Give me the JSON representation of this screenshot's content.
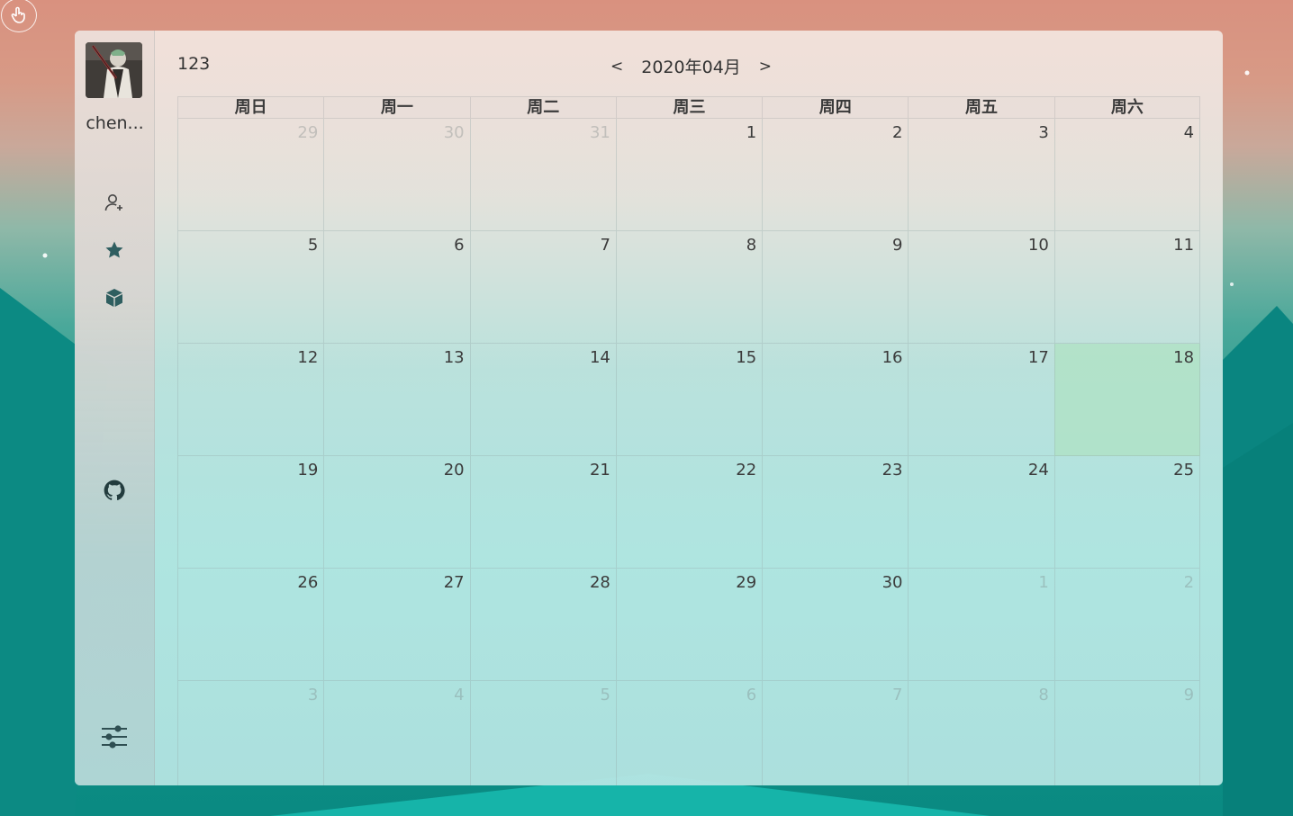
{
  "sidebar": {
    "username": "chen...",
    "icons": [
      "add-user-icon",
      "star-icon",
      "cube-icon",
      "github-icon",
      "settings-sliders-icon"
    ]
  },
  "header": {
    "title": "123",
    "prev_label": "<",
    "month": "2020年04月",
    "next_label": ">"
  },
  "calendar": {
    "weekdays": [
      "周日",
      "周一",
      "周二",
      "周三",
      "周四",
      "周五",
      "周六"
    ],
    "today": 18,
    "days": [
      {
        "n": "29",
        "current": false
      },
      {
        "n": "30",
        "current": false
      },
      {
        "n": "31",
        "current": false
      },
      {
        "n": "1",
        "current": true
      },
      {
        "n": "2",
        "current": true
      },
      {
        "n": "3",
        "current": true
      },
      {
        "n": "4",
        "current": true
      },
      {
        "n": "5",
        "current": true
      },
      {
        "n": "6",
        "current": true
      },
      {
        "n": "7",
        "current": true
      },
      {
        "n": "8",
        "current": true
      },
      {
        "n": "9",
        "current": true
      },
      {
        "n": "10",
        "current": true
      },
      {
        "n": "11",
        "current": true
      },
      {
        "n": "12",
        "current": true
      },
      {
        "n": "13",
        "current": true
      },
      {
        "n": "14",
        "current": true
      },
      {
        "n": "15",
        "current": true
      },
      {
        "n": "16",
        "current": true
      },
      {
        "n": "17",
        "current": true
      },
      {
        "n": "18",
        "current": true
      },
      {
        "n": "19",
        "current": true
      },
      {
        "n": "20",
        "current": true
      },
      {
        "n": "21",
        "current": true
      },
      {
        "n": "22",
        "current": true
      },
      {
        "n": "23",
        "current": true
      },
      {
        "n": "24",
        "current": true
      },
      {
        "n": "25",
        "current": true
      },
      {
        "n": "26",
        "current": true
      },
      {
        "n": "27",
        "current": true
      },
      {
        "n": "28",
        "current": true
      },
      {
        "n": "29",
        "current": true
      },
      {
        "n": "30",
        "current": true
      },
      {
        "n": "1",
        "current": false
      },
      {
        "n": "2",
        "current": false
      },
      {
        "n": "3",
        "current": false
      },
      {
        "n": "4",
        "current": false
      },
      {
        "n": "5",
        "current": false
      },
      {
        "n": "6",
        "current": false
      },
      {
        "n": "7",
        "current": false
      },
      {
        "n": "8",
        "current": false
      },
      {
        "n": "9",
        "current": false
      }
    ]
  },
  "colors": {
    "today_highlight": "#afe1c3",
    "text": "#333333",
    "muted_text": "#9aa5a5"
  }
}
